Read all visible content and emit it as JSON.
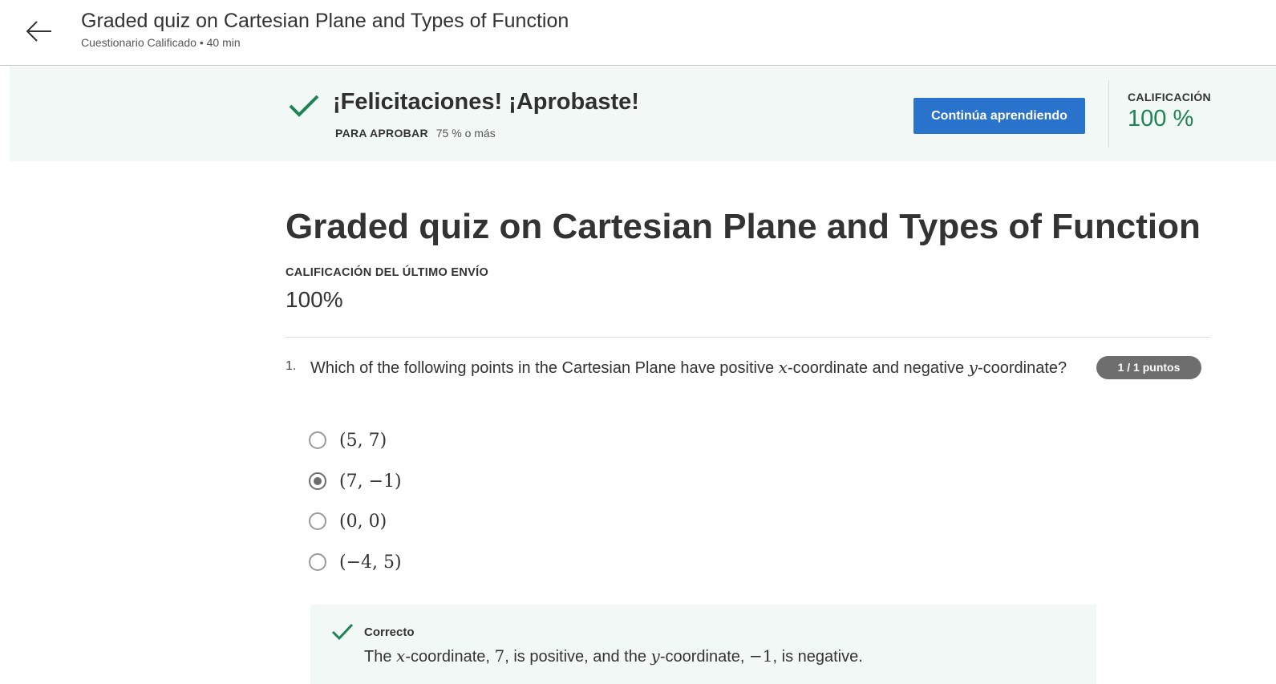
{
  "header": {
    "title": "Graded quiz on Cartesian Plane and Types of Function",
    "subtitle": "Cuestionario Calificado • 40 min"
  },
  "banner": {
    "title": "¡Felicitaciones! ¡Aprobaste!",
    "pass_label": "PARA APROBAR",
    "pass_value": "75 % o más",
    "continue_label": "Continúa aprendiendo",
    "grade_label": "CALIFICACIÓN",
    "grade_value": "100 %"
  },
  "main": {
    "title": "Graded quiz on Cartesian Plane and Types of Function",
    "last_submission_label": "CALIFICACIÓN DEL ÚLTIMO ENVÍO",
    "last_submission_value": "100%"
  },
  "question": {
    "number": "1.",
    "text_part1": "Which of the following points in the Cartesian Plane have positive ",
    "var_x": "x",
    "text_part2": "-coordinate and negative ",
    "var_y": "y",
    "text_part3": "-coordinate?",
    "points": "1 / 1 puntos",
    "options": [
      {
        "label": "(5, 7)",
        "selected": false
      },
      {
        "label": "(7, −1)",
        "selected": true
      },
      {
        "label": "(0, 0)",
        "selected": false
      },
      {
        "label": "(−4, 5)",
        "selected": false
      }
    ],
    "feedback": {
      "label": "Correcto",
      "part1": "The ",
      "var_x": "x",
      "part2": "-coordinate, ",
      "val_x": "7",
      "part3": ", is positive, and the ",
      "var_y": "y",
      "part4": "-coordinate, ",
      "val_y": "−1",
      "part5": ", is negative."
    }
  },
  "colors": {
    "accent_blue": "#2a73cc",
    "success_green": "#1f8354",
    "banner_bg": "#f1f8f6"
  }
}
